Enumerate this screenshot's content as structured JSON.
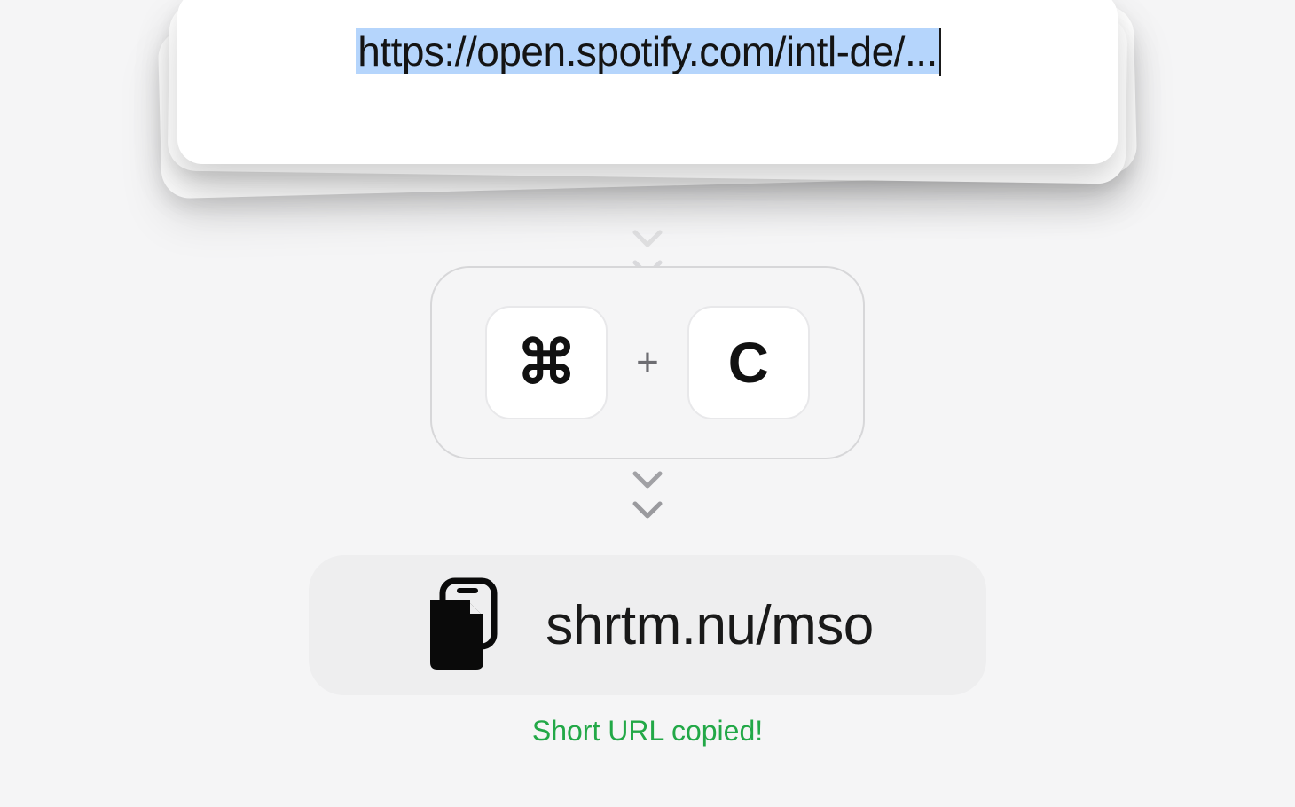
{
  "input": {
    "url_display": "https://open.spotify.com/intl-de/..."
  },
  "shortcut": {
    "key1_glyph": "⌘",
    "plus": "+",
    "key2_label": "C"
  },
  "result": {
    "short_url": "shrtm.nu/mso"
  },
  "status": {
    "copied_message": "Short URL copied!"
  },
  "colors": {
    "selection": "#b5d5fc",
    "success": "#22a847"
  }
}
